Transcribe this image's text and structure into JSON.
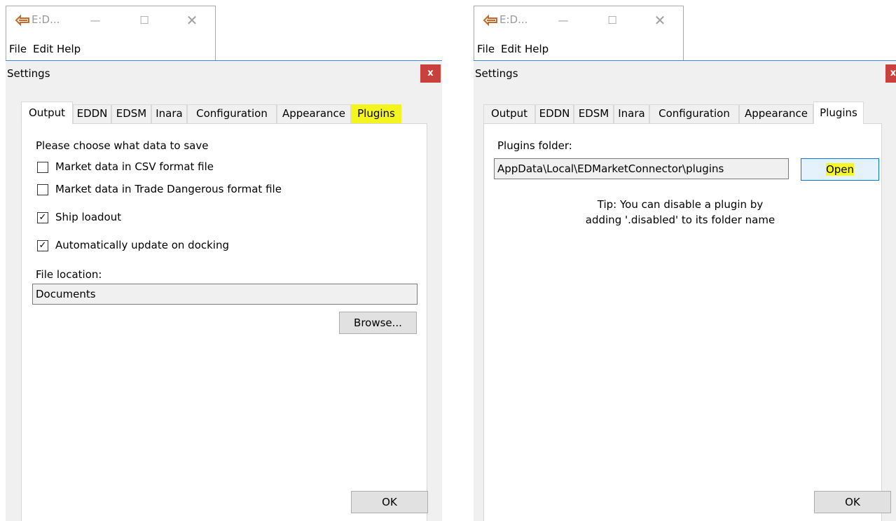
{
  "left": {
    "app_title": "E:D...",
    "menu": [
      "File",
      "Edit",
      "Help"
    ],
    "dialog_title": "Settings",
    "close_label": "x",
    "tabs": [
      "Output",
      "EDDN",
      "EDSM",
      "Inara",
      "Configuration",
      "Appearance",
      "Plugins"
    ],
    "active_tab": "Output",
    "highlighted_tab": "Plugins",
    "choose_label": "Please choose what data to save",
    "options": [
      {
        "label": "Market data in CSV format file",
        "checked": false
      },
      {
        "label": "Market data in Trade Dangerous format file",
        "checked": false
      },
      {
        "label": "Ship loadout",
        "checked": true
      },
      {
        "label": "Automatically update on docking",
        "checked": true
      }
    ],
    "file_location_label": "File location:",
    "file_location_value": "Documents",
    "browse_label": "Browse...",
    "ok_label": "OK"
  },
  "right": {
    "app_title": "E:D...",
    "menu": [
      "File",
      "Edit",
      "Help"
    ],
    "dialog_title": "Settings",
    "close_label": "x",
    "tabs": [
      "Output",
      "EDDN",
      "EDSM",
      "Inara",
      "Configuration",
      "Appearance",
      "Plugins"
    ],
    "active_tab": "Plugins",
    "plugins_folder_label": "Plugins folder:",
    "plugins_folder_value": "AppData\\Local\\EDMarketConnector\\plugins",
    "open_label": "Open",
    "tip_line1": "Tip: You can disable a plugin by",
    "tip_line2": "adding '.disabled' to its folder name",
    "ok_label": "OK"
  },
  "colors": {
    "highlight": "#f4f51e",
    "close_button": "#c9413c",
    "accent_line": "#3c8ad6",
    "dialog_bg": "#f0f0f0"
  },
  "icons": [
    "app-icon",
    "minimize-icon",
    "maximize-icon",
    "close-icon",
    "checkbox-checked-icon"
  ]
}
